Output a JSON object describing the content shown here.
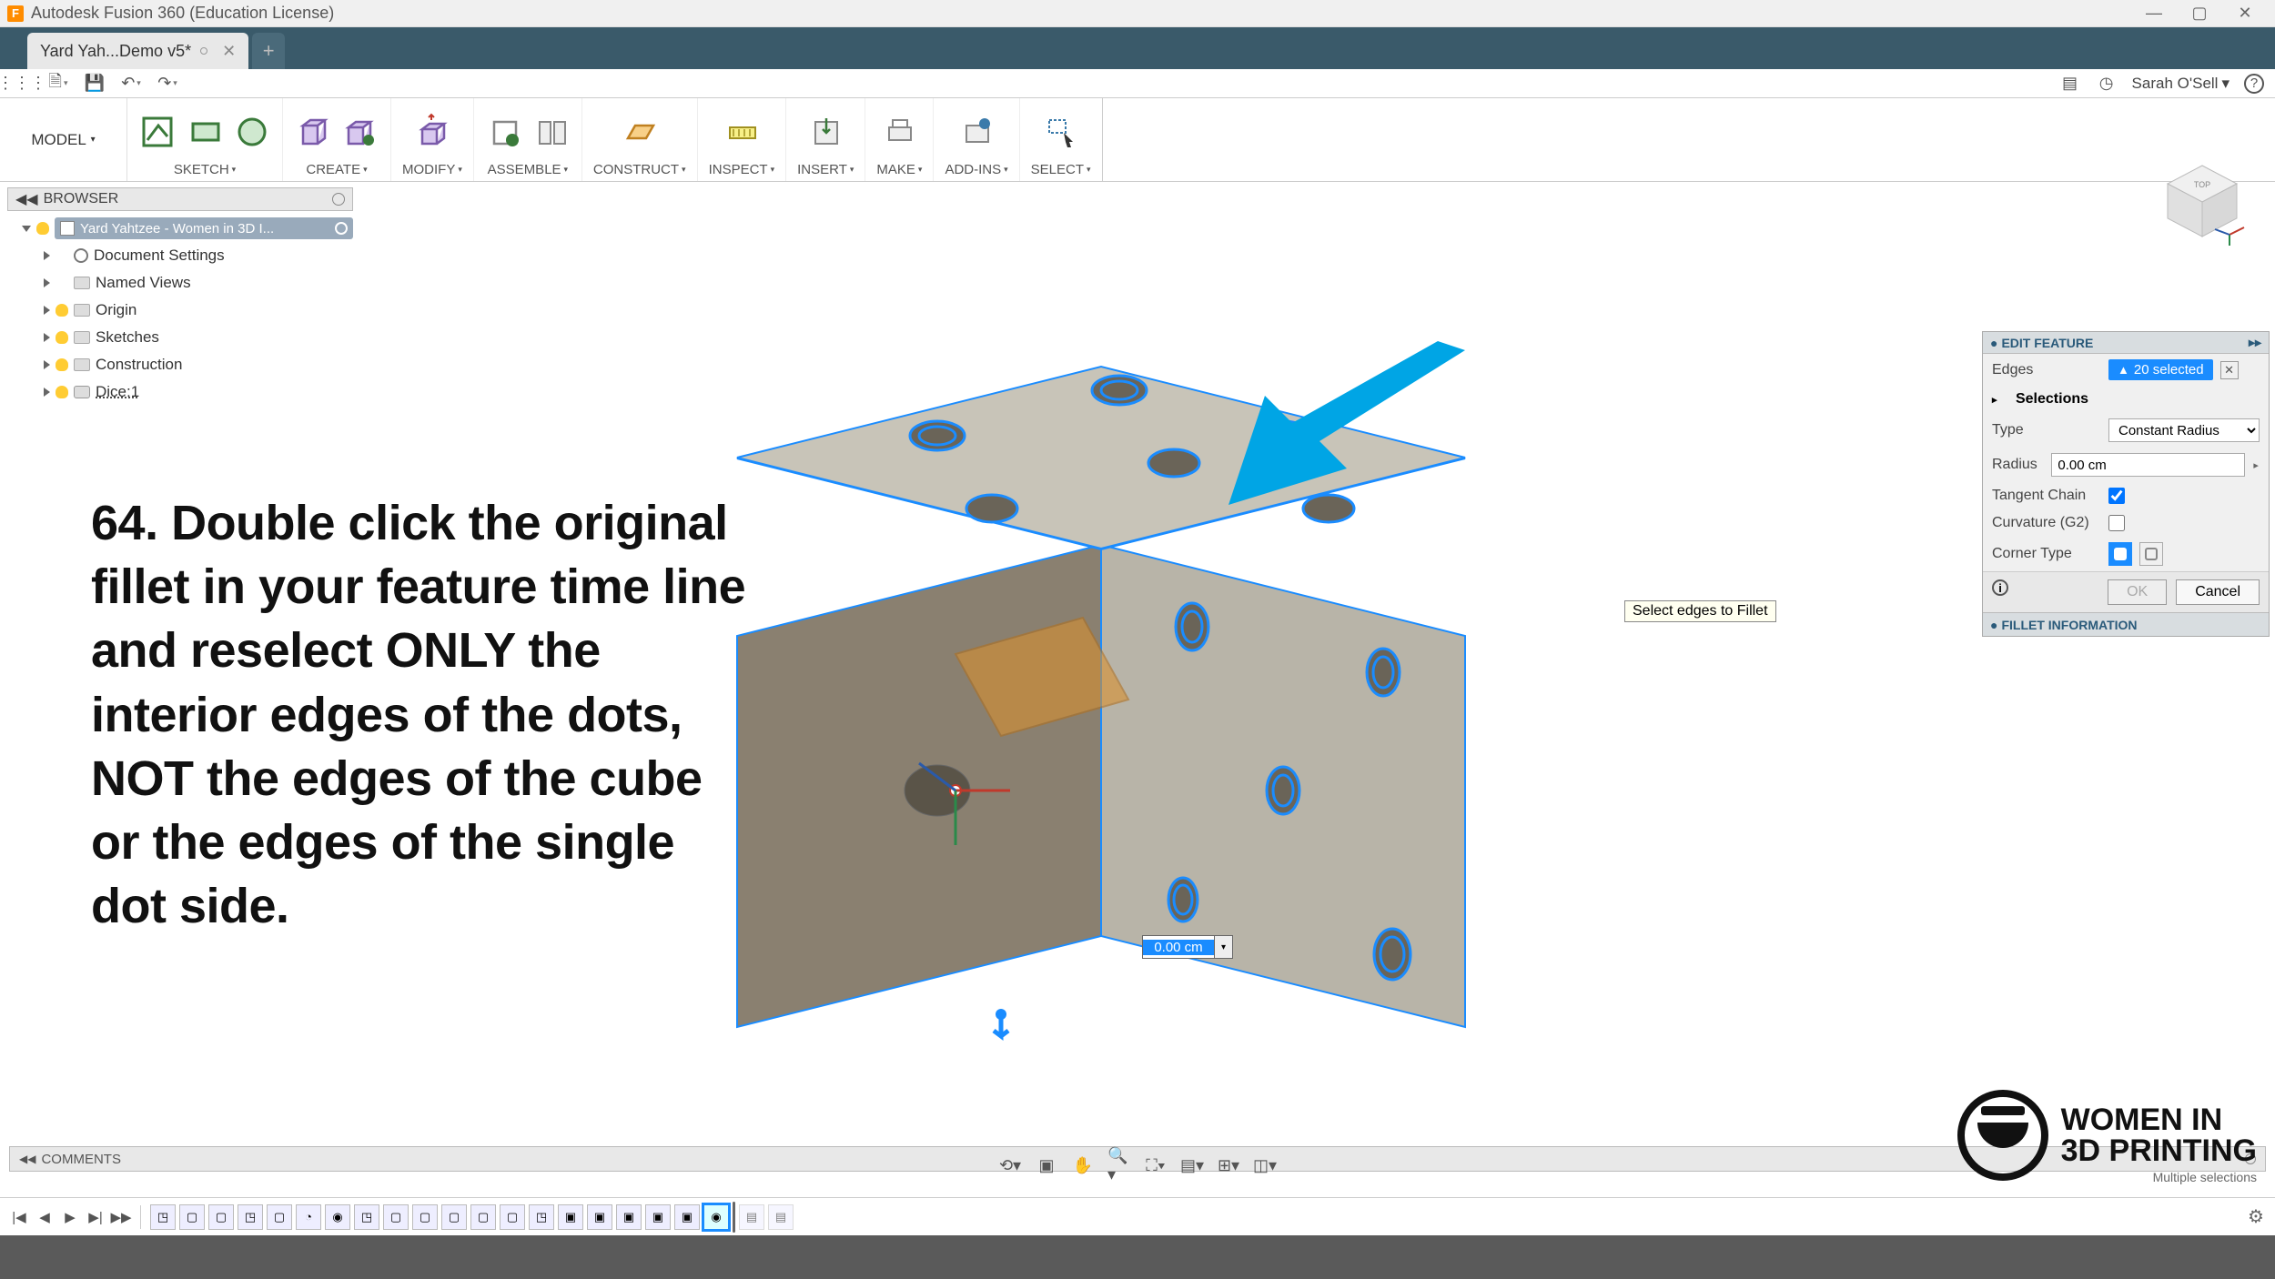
{
  "titlebar": {
    "title": "Autodesk Fusion 360 (Education License)"
  },
  "tab": {
    "label": "Yard Yah...Demo v5*"
  },
  "quickbar": {
    "user": "Sarah O'Sell"
  },
  "ribbon": {
    "workspace": "MODEL",
    "groups": [
      {
        "key": "sketch",
        "label": "SKETCH"
      },
      {
        "key": "create",
        "label": "CREATE"
      },
      {
        "key": "modify",
        "label": "MODIFY"
      },
      {
        "key": "assemble",
        "label": "ASSEMBLE"
      },
      {
        "key": "construct",
        "label": "CONSTRUCT"
      },
      {
        "key": "inspect",
        "label": "INSPECT"
      },
      {
        "key": "insert",
        "label": "INSERT"
      },
      {
        "key": "make",
        "label": "MAKE"
      },
      {
        "key": "addins",
        "label": "ADD-INS"
      },
      {
        "key": "select",
        "label": "SELECT"
      }
    ]
  },
  "browser": {
    "title": "BROWSER",
    "root": "Yard Yahtzee - Women in 3D I...",
    "items": [
      {
        "label": "Document Settings",
        "bulb": false,
        "icon": "gear"
      },
      {
        "label": "Named Views",
        "bulb": false,
        "icon": "folder"
      },
      {
        "label": "Origin",
        "bulb": true,
        "icon": "folder"
      },
      {
        "label": "Sketches",
        "bulb": true,
        "icon": "folder"
      },
      {
        "label": "Construction",
        "bulb": true,
        "icon": "folder"
      },
      {
        "label": "Dice:1",
        "bulb": true,
        "icon": "body",
        "underline": true
      }
    ]
  },
  "instruction": "64. Double click the original fillet in your feature time line and reselect ONLY the interior edges of the dots, NOT the edges of the cube or the edges of the single dot side.",
  "tooltip": "Select edges to Fillet",
  "diminput": "0.00 cm",
  "editfeature": {
    "title": "EDIT FEATURE",
    "edges_label": "Edges",
    "edges_count": "20 selected",
    "selections_label": "Selections",
    "type_label": "Type",
    "type_value": "Constant Radius",
    "radius_label": "Radius",
    "radius_value": "0.00 cm",
    "tangent_label": "Tangent Chain",
    "tangent_checked": true,
    "curvature_label": "Curvature (G2)",
    "curvature_checked": false,
    "corner_label": "Corner Type",
    "ok": "OK",
    "cancel": "Cancel",
    "fillet_info_title": "FILLET INFORMATION"
  },
  "comments": {
    "label": "COMMENTS"
  },
  "status_hint": "Multiple selections",
  "logo": {
    "line1": "WOMEN IN",
    "line2": "3D PRINTING"
  },
  "colors": {
    "accent": "#1a8cff",
    "arrow": "#00a5e5"
  }
}
